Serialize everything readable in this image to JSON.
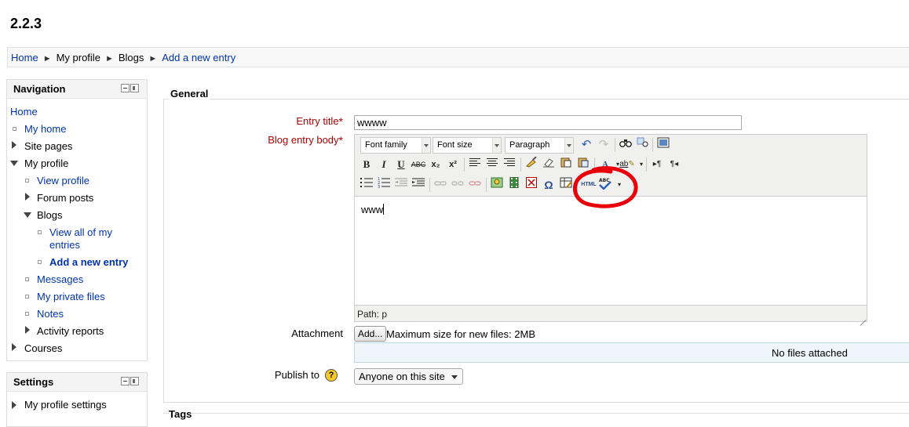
{
  "page": {
    "title": "2.2.3"
  },
  "breadcrumb": {
    "items": [
      "Home",
      "My profile",
      "Blogs",
      "Add a new entry"
    ],
    "separator": "►"
  },
  "navigation": {
    "header": "Navigation",
    "items": [
      {
        "label": "Home"
      },
      {
        "label": "My home"
      },
      {
        "label": "Site pages"
      },
      {
        "label": "My profile"
      },
      {
        "label": "View profile"
      },
      {
        "label": "Forum posts"
      },
      {
        "label": "Blogs"
      },
      {
        "label": "View all of my entries"
      },
      {
        "label": "Add a new entry"
      },
      {
        "label": "Messages"
      },
      {
        "label": "My private files"
      },
      {
        "label": "Notes"
      },
      {
        "label": "Activity reports"
      },
      {
        "label": "Courses"
      }
    ]
  },
  "settings": {
    "header": "Settings",
    "items": [
      {
        "label": "My profile settings"
      }
    ]
  },
  "form": {
    "legend": "General",
    "next_legend": "Tags",
    "required_mark": "*",
    "entry_title_label": "Entry title",
    "entry_title_value": "wwww",
    "body_label": "Blog entry body",
    "editor": {
      "font_family": "Font family",
      "font_size": "Font size",
      "format": "Paragraph",
      "content": "www",
      "path_label": "Path: p",
      "buttons": {
        "bold": "B",
        "italic": "I",
        "underline": "U",
        "strike": "ABC",
        "subscript": "x₂",
        "superscript": "x²",
        "omega": "Ω",
        "html": "HTML",
        "spell": "ABC"
      }
    },
    "attachment_label": "Attachment",
    "add_button": "Add...",
    "max_size": "Maximum size for new files: 2MB",
    "no_files": "No files attached",
    "publish_label": "Publish to",
    "publish_help": "?",
    "publish_value": "Anyone on this site"
  },
  "colors": {
    "link": "#0033aa",
    "required": "#aa0000",
    "annotation": "#e8000b",
    "files_bg": "#eef6fb"
  }
}
